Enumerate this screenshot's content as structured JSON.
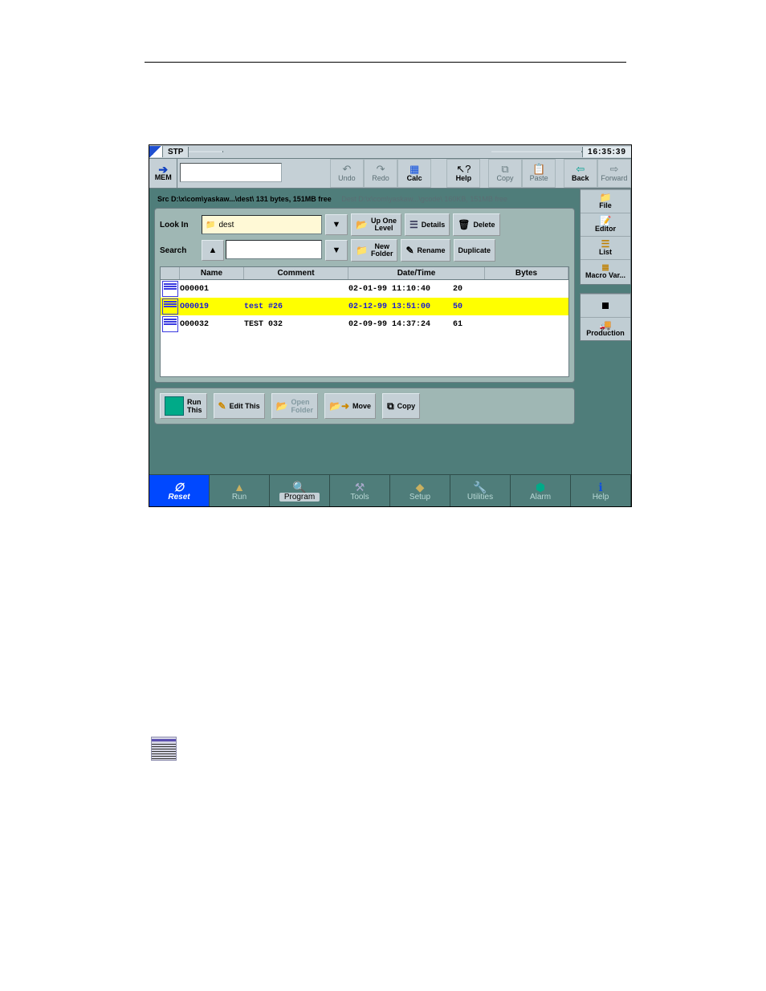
{
  "titlebar": {
    "stp": "STP",
    "clock": "16:35:39"
  },
  "mem_label": "MEM",
  "toolbar": {
    "undo": "Undo",
    "redo": "Redo",
    "calc": "Calc",
    "help": "Help",
    "copy": "Copy",
    "paste": "Paste",
    "back": "Back",
    "forward": "Forward"
  },
  "status": {
    "src": "Src D:\\x\\com\\yaskaw...\\dest\\   131 bytes, 151MB free",
    "dest": "Dest D:\\x\\com\\yaskaw...\\gcode\\   160KB, 151MB free"
  },
  "controls": {
    "lookin_label": "Look In",
    "lookin_value": "dest",
    "search_label": "Search",
    "upone": "Up One\nLevel",
    "details": "Details",
    "delete": "Delete",
    "newfolder": "New\nFolder",
    "rename": "Rename",
    "duplicate": "Duplicate"
  },
  "columns": {
    "name": "Name",
    "comment": "Comment",
    "datetime": "Date/Time",
    "bytes": "Bytes"
  },
  "files": [
    {
      "name": "O00001",
      "comment": "",
      "dt": "02-01-99 11:10:40",
      "bytes": "20",
      "sel": false
    },
    {
      "name": "O00019",
      "comment": "test #26",
      "dt": "02-12-99 13:51:00",
      "bytes": "50",
      "sel": true
    },
    {
      "name": "O00032",
      "comment": "TEST 032",
      "dt": "02-09-99 14:37:24",
      "bytes": "61",
      "sel": false
    }
  ],
  "panel_buttons": {
    "runthis": "Run\nThis",
    "editthis": "Edit This",
    "openfolder": "Open\nFolder",
    "move": "Move",
    "copy": "Copy"
  },
  "sidebar": {
    "file": "File",
    "editor": "Editor",
    "list": "List",
    "macro": "Macro Var...",
    "production": "Production"
  },
  "nav": {
    "reset": "Reset",
    "run": "Run",
    "program": "Program",
    "tools": "Tools",
    "setup": "Setup",
    "utilities": "Utilities",
    "alarm": "Alarm",
    "help": "Help"
  }
}
